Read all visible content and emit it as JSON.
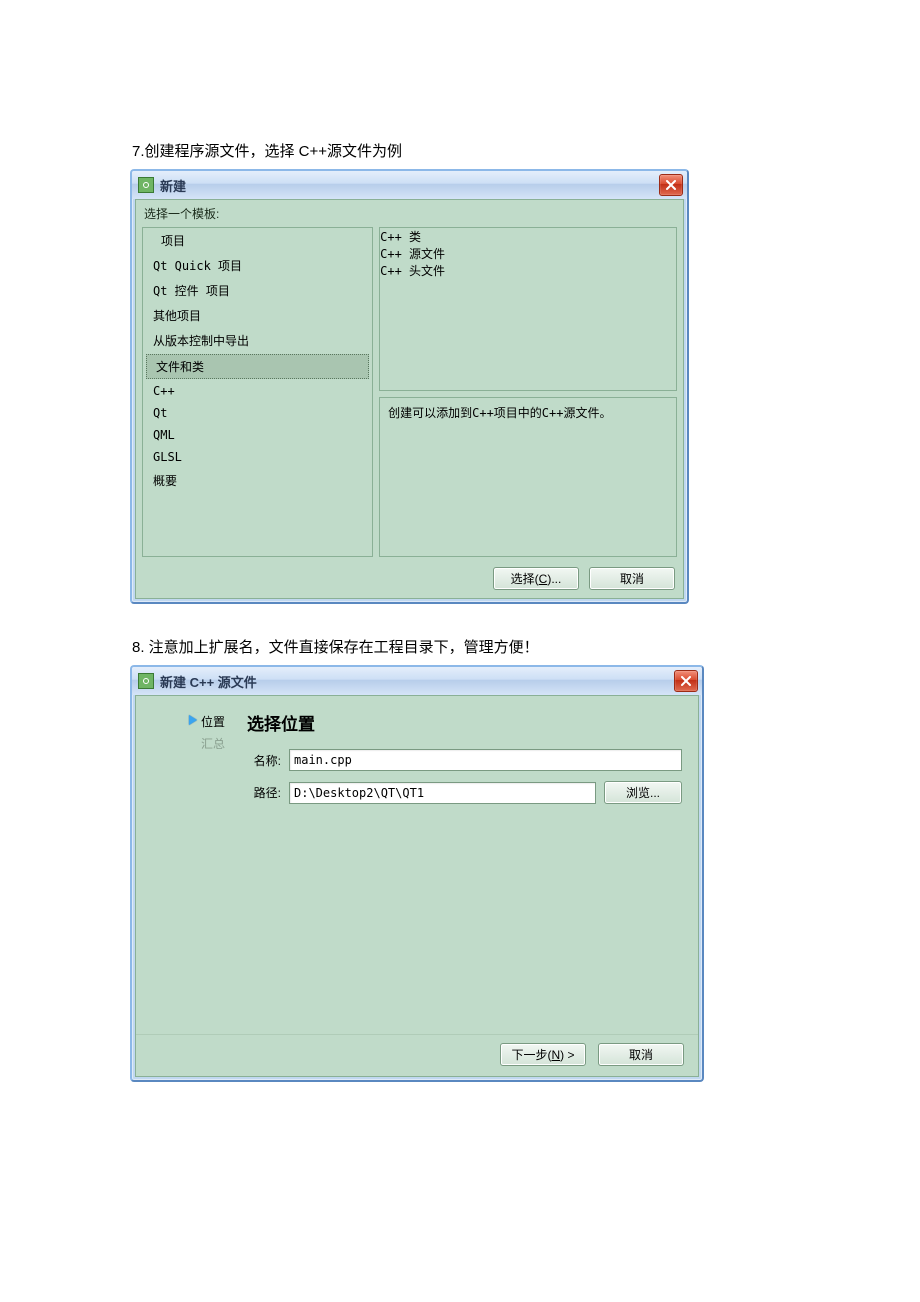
{
  "step7": {
    "caption": "7.创建程序源文件，选择 C++源文件为例",
    "window_title": "新建",
    "subhead": "选择一个模板:",
    "left_list": {
      "items": [
        {
          "label": "项目",
          "indent": true,
          "selected": false
        },
        {
          "label": "Qt Quick 项目",
          "indent": false,
          "selected": false
        },
        {
          "label": "Qt 控件 项目",
          "indent": false,
          "selected": false
        },
        {
          "label": "其他项目",
          "indent": false,
          "selected": false
        },
        {
          "label": "从版本控制中导出",
          "indent": false,
          "selected": false
        },
        {
          "label": "文件和类",
          "indent": true,
          "selected": true
        },
        {
          "label": "C++",
          "indent": false,
          "selected": false
        },
        {
          "label": "Qt",
          "indent": false,
          "selected": false
        },
        {
          "label": "QML",
          "indent": false,
          "selected": false
        },
        {
          "label": "GLSL",
          "indent": false,
          "selected": false
        },
        {
          "label": "概要",
          "indent": false,
          "selected": false
        }
      ]
    },
    "right_top": {
      "items": [
        {
          "label": "C++ 类",
          "selected": false
        },
        {
          "label": "C++ 源文件",
          "selected": true
        },
        {
          "label": "C++ 头文件",
          "selected": false
        }
      ]
    },
    "right_bot": "创建可以添加到C++项目中的C++源文件。",
    "btn_choose_pre": "选择(",
    "btn_choose_u": "C",
    "btn_choose_post": ")...",
    "btn_cancel": "取消"
  },
  "step8": {
    "caption": "8. 注意加上扩展名，文件直接保存在工程目录下，管理方便！",
    "window_title": "新建 C++ 源文件",
    "sidebar": {
      "item_cur": "位置",
      "item_next": "汇总"
    },
    "heading": "选择位置",
    "name_label": "名称:",
    "name_value": "main.cpp",
    "path_label": "路径:",
    "path_value": "D:\\Desktop2\\QT\\QT1",
    "browse": "浏览...",
    "next_pre": "下一步(",
    "next_u": "N",
    "next_post": ") >",
    "cancel": "取消"
  }
}
